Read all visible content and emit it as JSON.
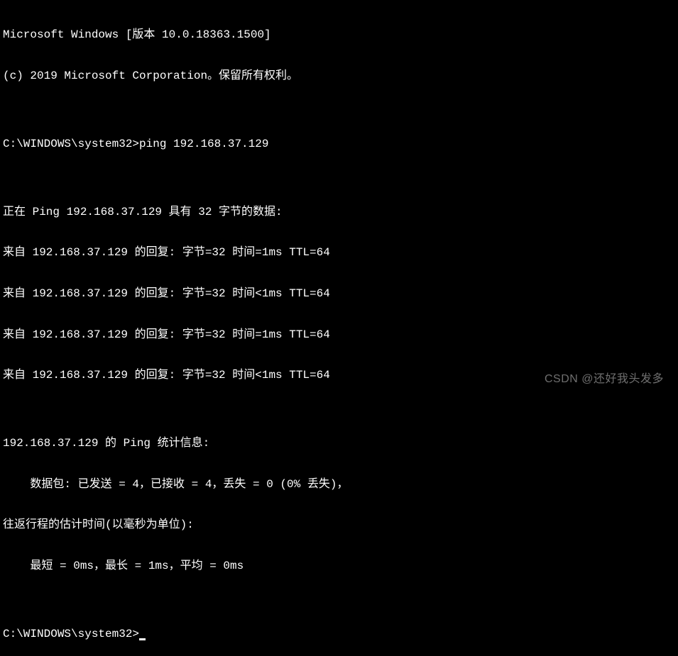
{
  "terminal": {
    "lines": [
      "Microsoft Windows [版本 10.0.18363.1500]",
      "(c) 2019 Microsoft Corporation。保留所有权利。",
      "",
      "C:\\WINDOWS\\system32>ping 192.168.37.129",
      "",
      "正在 Ping 192.168.37.129 具有 32 字节的数据:",
      "来自 192.168.37.129 的回复: 字节=32 时间=1ms TTL=64",
      "来自 192.168.37.129 的回复: 字节=32 时间<1ms TTL=64",
      "来自 192.168.37.129 的回复: 字节=32 时间=1ms TTL=64",
      "来自 192.168.37.129 的回复: 字节=32 时间<1ms TTL=64",
      "",
      "192.168.37.129 的 Ping 统计信息:",
      "    数据包: 已发送 = 4，已接收 = 4，丢失 = 0 (0% 丢失)，",
      "往返行程的估计时间(以毫秒为单位):",
      "    最短 = 0ms，最长 = 1ms，平均 = 0ms",
      "",
      "C:\\WINDOWS\\system32>"
    ]
  },
  "watermark": "CSDN @还好我头发多"
}
